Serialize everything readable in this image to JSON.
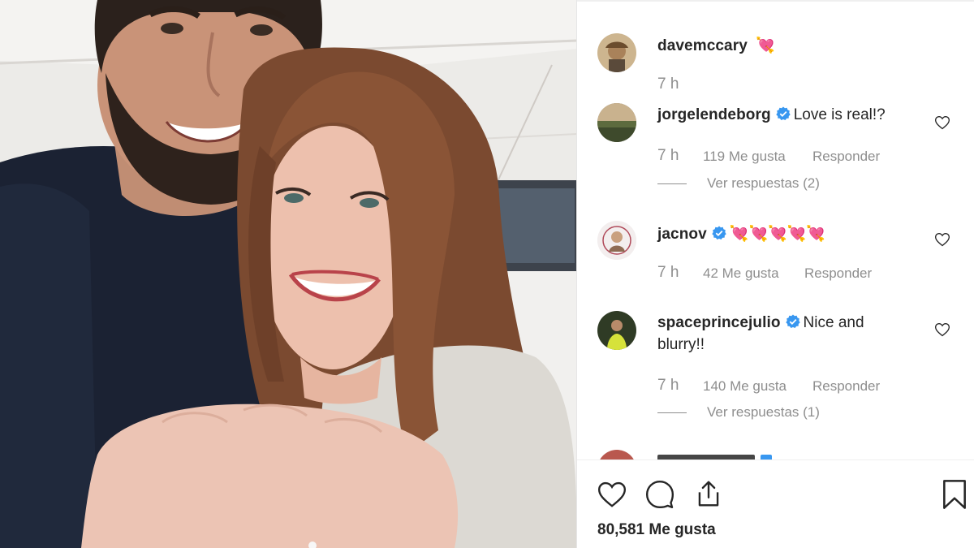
{
  "post": {
    "author": "davemccary",
    "caption_emoji": "💘",
    "time": "7 h"
  },
  "comments": [
    {
      "username": "jorgelendeborg",
      "verified": true,
      "text": "Love is real!?",
      "time": "7 h",
      "likes": "119 Me gusta",
      "reply": "Responder",
      "view_replies": "Ver respuestas (2)"
    },
    {
      "username": "jacnov",
      "verified": true,
      "text": "💘💘💘💘💘",
      "time": "7 h",
      "likes": "42 Me gusta",
      "reply": "Responder"
    },
    {
      "username": "spaceprincejulio",
      "verified": true,
      "text_line1": "Nice and",
      "text_line2": "blurry!!",
      "time": "7 h",
      "likes": "140 Me gusta",
      "reply": "Responder",
      "view_replies": "Ver respuestas (1)"
    }
  ],
  "footer": {
    "likes_count": "80,581 Me gusta"
  },
  "icons": {
    "like": "heart-icon",
    "comment": "comment-icon",
    "share": "share-icon",
    "save": "bookmark-icon",
    "verified": "verified-badge-icon"
  },
  "colors": {
    "text": "#262626",
    "meta": "#8e8e8e",
    "verified": "#3897f0"
  }
}
